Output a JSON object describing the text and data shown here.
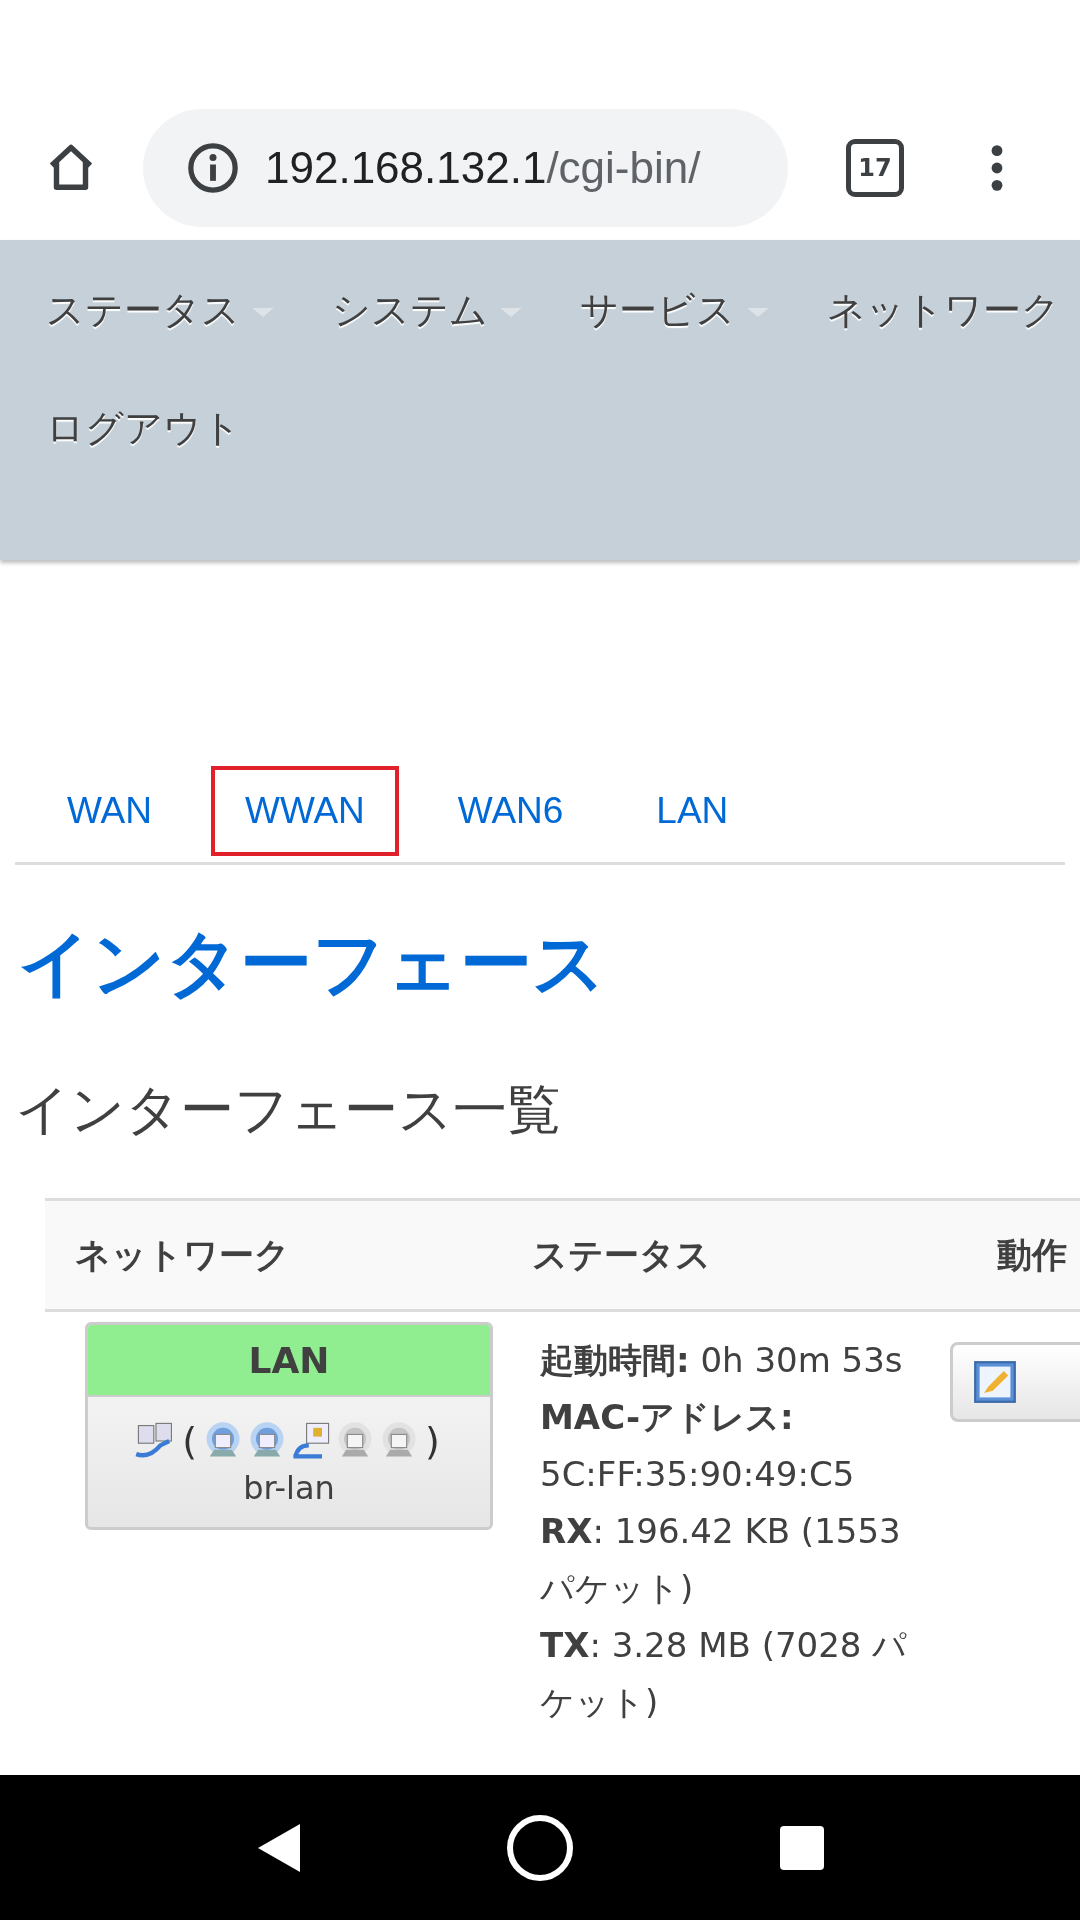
{
  "browser": {
    "url_host": "192.168.132.1",
    "url_path": "/cgi-bin/",
    "tab_count": "17"
  },
  "nav": {
    "items": [
      {
        "label": "ステータス",
        "has_dropdown": true
      },
      {
        "label": "システム",
        "has_dropdown": true
      },
      {
        "label": "サービス",
        "has_dropdown": true
      },
      {
        "label": "ネットワーク",
        "has_dropdown": false
      },
      {
        "label": "ログアウト",
        "has_dropdown": false
      }
    ]
  },
  "tabs": [
    {
      "label": "WAN",
      "highlighted": false
    },
    {
      "label": "WWAN",
      "highlighted": true
    },
    {
      "label": "WAN6",
      "highlighted": false
    },
    {
      "label": "LAN",
      "highlighted": false
    }
  ],
  "page_title": "インターフェース",
  "section_title": "インターフェース一覧",
  "table": {
    "columns": [
      "ネットワーク",
      "ステータス",
      "動作"
    ],
    "rows": [
      {
        "network": {
          "name": "LAN",
          "color": "#90ee90",
          "open_paren": "(",
          "close_paren": ")",
          "device": "br-lan",
          "ports": [
            {
              "kind": "wifi",
              "active": true
            },
            {
              "kind": "wifi",
              "active": true
            },
            {
              "kind": "ethernet",
              "active": true
            },
            {
              "kind": "wifi",
              "active": false
            },
            {
              "kind": "wifi",
              "active": false
            }
          ]
        },
        "status": [
          "**起動時間:** 0h 30m 53s",
          "**MAC-アドレス:** 5C:FF:35:90:49:C5",
          "**RX**: 196.42 KB (1553 パケット)",
          "**TX**: 3.28 MB (7028 パケット)"
        ]
      }
    ]
  }
}
